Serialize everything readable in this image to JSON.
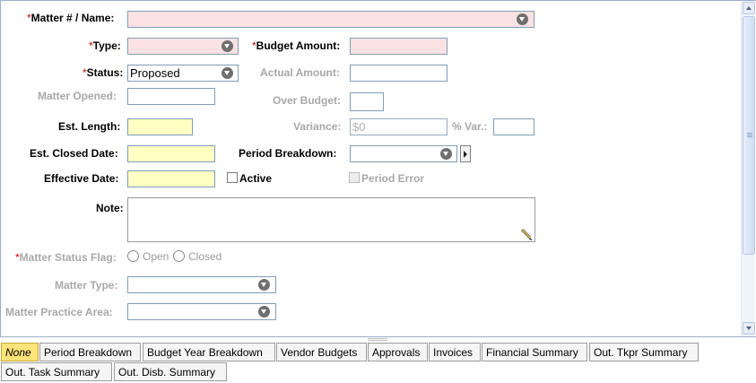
{
  "form": {
    "matter_name": {
      "label": "Matter # / Name:",
      "required": true,
      "value": ""
    },
    "type": {
      "label": "Type:",
      "required": true,
      "value": ""
    },
    "budget_amount": {
      "label": "Budget Amount:",
      "required": true,
      "value": ""
    },
    "status": {
      "label": "Status:",
      "required": true,
      "value": "Proposed"
    },
    "actual_amount": {
      "label": "Actual Amount:",
      "value": ""
    },
    "matter_opened": {
      "label": "Matter Opened:",
      "value": ""
    },
    "over_budget": {
      "label": "Over Budget:",
      "value": ""
    },
    "est_length": {
      "label": "Est. Length:",
      "value": ""
    },
    "variance": {
      "label": "Variance:",
      "value": "$0"
    },
    "pct_var": {
      "label": "% Var.:",
      "value": ""
    },
    "est_closed_date": {
      "label": "Est. Closed Date:",
      "value": ""
    },
    "period_breakdown": {
      "label": "Period Breakdown:",
      "value": ""
    },
    "effective_date": {
      "label": "Effective Date:",
      "value": ""
    },
    "active": {
      "label": "Active",
      "checked": false
    },
    "period_error": {
      "label": "Period Error",
      "checked": false
    },
    "note": {
      "label": "Note:",
      "value": ""
    },
    "matter_status_flag": {
      "label": "Matter Status Flag:",
      "required": true,
      "options": [
        "Open",
        "Closed"
      ],
      "selected": null
    },
    "matter_type": {
      "label": "Matter Type:",
      "value": ""
    },
    "matter_practice_area": {
      "label": "Matter Practice Area:",
      "value": ""
    }
  },
  "required_marker": "*",
  "tabs": [
    {
      "label": "None",
      "active": true
    },
    {
      "label": "Period Breakdown",
      "active": false
    },
    {
      "label": "Budget Year Breakdown",
      "active": false
    },
    {
      "label": "Vendor Budgets",
      "active": false
    },
    {
      "label": "Approvals",
      "active": false
    },
    {
      "label": "Invoices",
      "active": false
    },
    {
      "label": "Financial Summary",
      "active": false
    },
    {
      "label": "Out. Tkpr Summary",
      "active": false
    },
    {
      "label": "Out. Task Summary",
      "active": false
    },
    {
      "label": "Out. Disb. Summary",
      "active": false
    }
  ],
  "colors": {
    "required_field": "#fbe2e2",
    "date_field": "#ffffc4",
    "active_tab": "#fde37a",
    "required_marker": "#cc0000"
  }
}
